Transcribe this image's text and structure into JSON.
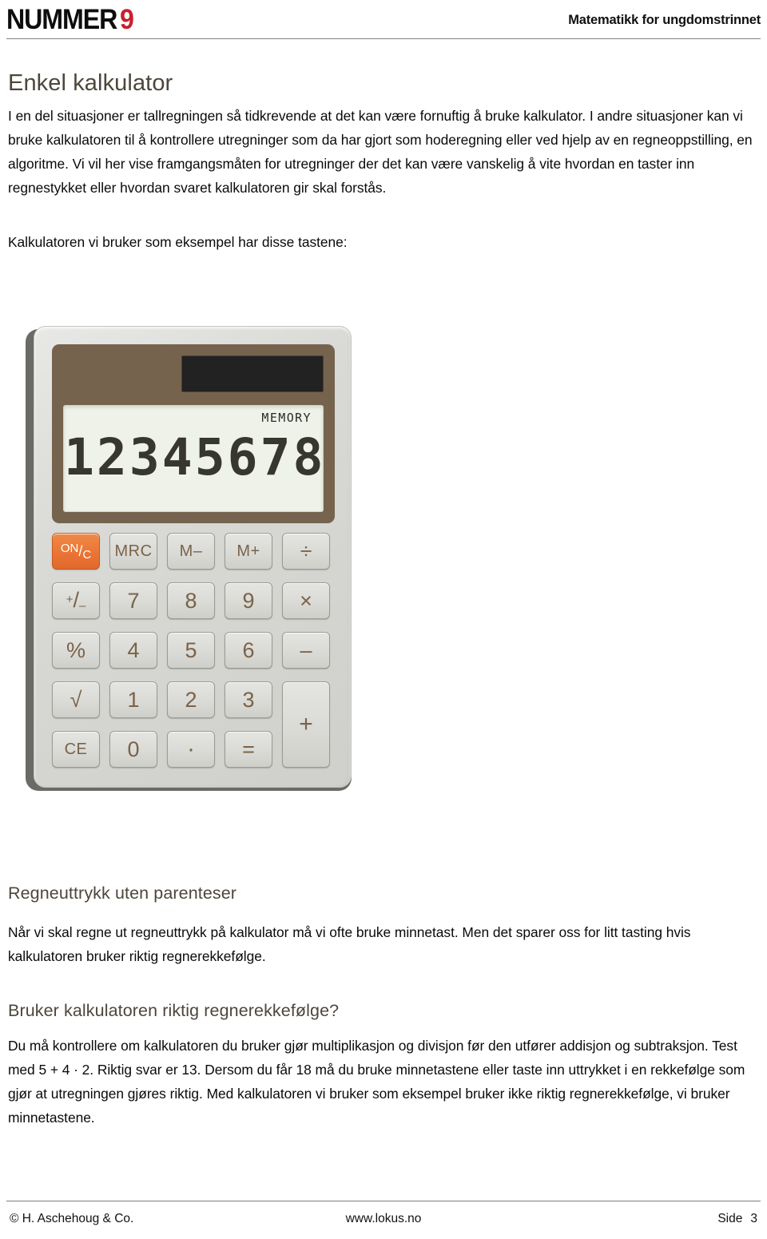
{
  "header": {
    "logo_word": "NUMMER",
    "logo_number": "9",
    "tagline": "Matematikk for ungdomstrinnet"
  },
  "document": {
    "title": "Enkel kalkulator",
    "paragraphs": {
      "intro": "I en del situasjoner er tallregningen så tidkrevende at det kan være fornuftig å bruke kalkulator. I andre situasjoner kan vi bruke kalkulatoren til å kontrollere utregninger som da har gjort som hoderegning eller ved hjelp av en regneoppstilling, en algoritme. Vi vil her vise framgangsmåten for utregninger der det kan være vanskelig å vite hvordan en taster inn regnestykket eller hvordan svaret kalkulatoren gir skal forstås.",
      "lead": "Kalkulatoren vi bruker som eksempel har disse tastene:",
      "regneuttrykk": "Når vi skal regne ut regneuttrykk på kalkulator må vi ofte bruke minnetast. Men det sparer oss for litt tasting hvis kalkulatoren bruker riktig regnerekkefølge.",
      "rekkefolge": "Du må kontrollere om kalkulatoren du bruker gjør multiplikasjon og divisjon før den utfører addisjon og subtraksjon. Test med 5 + 4 · 2. Riktig svar er 13. Dersom du får 18 må du bruke minnetastene eller taste inn uttrykket i en rekkefølge som gjør at utregningen gjøres riktig. Med kalkulatoren vi bruker som eksempel bruker ikke riktig regnerekkefølge, vi bruker minnetastene."
    },
    "sections": {
      "regneuttrykk_title": "Regneuttrykk uten parenteser",
      "rekkefolge_title": "Bruker kalkulatoren riktig regnerekkefølge?"
    }
  },
  "calculator": {
    "display_value": "12345678",
    "memory_indicator": "MEMORY",
    "keys": {
      "onc_top": "ON",
      "onc_bottom": "C",
      "onc_slash": "/",
      "mrc": "MRC",
      "mminus": "M–",
      "mplus": "M+",
      "divide": "÷",
      "plusminus_top": "+",
      "plusminus_slash": "/",
      "plusminus_bottom": "–",
      "seven": "7",
      "eight": "8",
      "nine": "9",
      "multiply": "×",
      "percent": "%",
      "four": "4",
      "five": "5",
      "six": "6",
      "minus": "–",
      "sqrt": "√",
      "one": "1",
      "two": "2",
      "three": "3",
      "plus": "+",
      "ce": "CE",
      "zero": "0",
      "dot": "·",
      "equals": "="
    },
    "colors": {
      "body": "#d9d9d6",
      "top_panel": "#75634e",
      "lcd": "#eef2e8",
      "onc_key": "#ea7334",
      "key_text": "#7a6348"
    }
  },
  "footer": {
    "copyright": "© H. Aschehoug & Co.",
    "website": "www.lokus.no",
    "page_label": "Side",
    "page_number": "3"
  }
}
